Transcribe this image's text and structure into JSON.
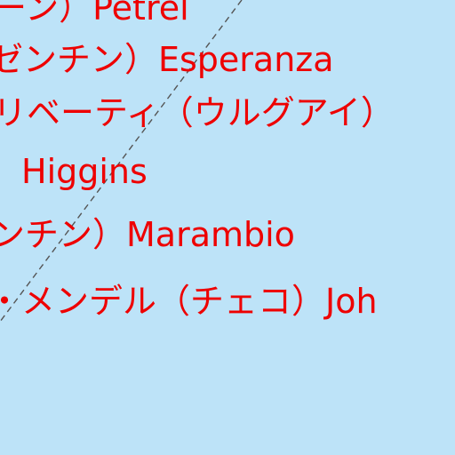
{
  "map": {
    "background_color": "#bde3f8",
    "label_color": "#ee0000",
    "boundary_color": "#555555",
    "labels": [
      "ーン）Petrel",
      "ゼンチン）Esperanza",
      "リベーティ（ウルグアイ）",
      "゛Higgins",
      "ンチン）Marambio",
      "・メンデル（チェコ）Joh"
    ]
  }
}
